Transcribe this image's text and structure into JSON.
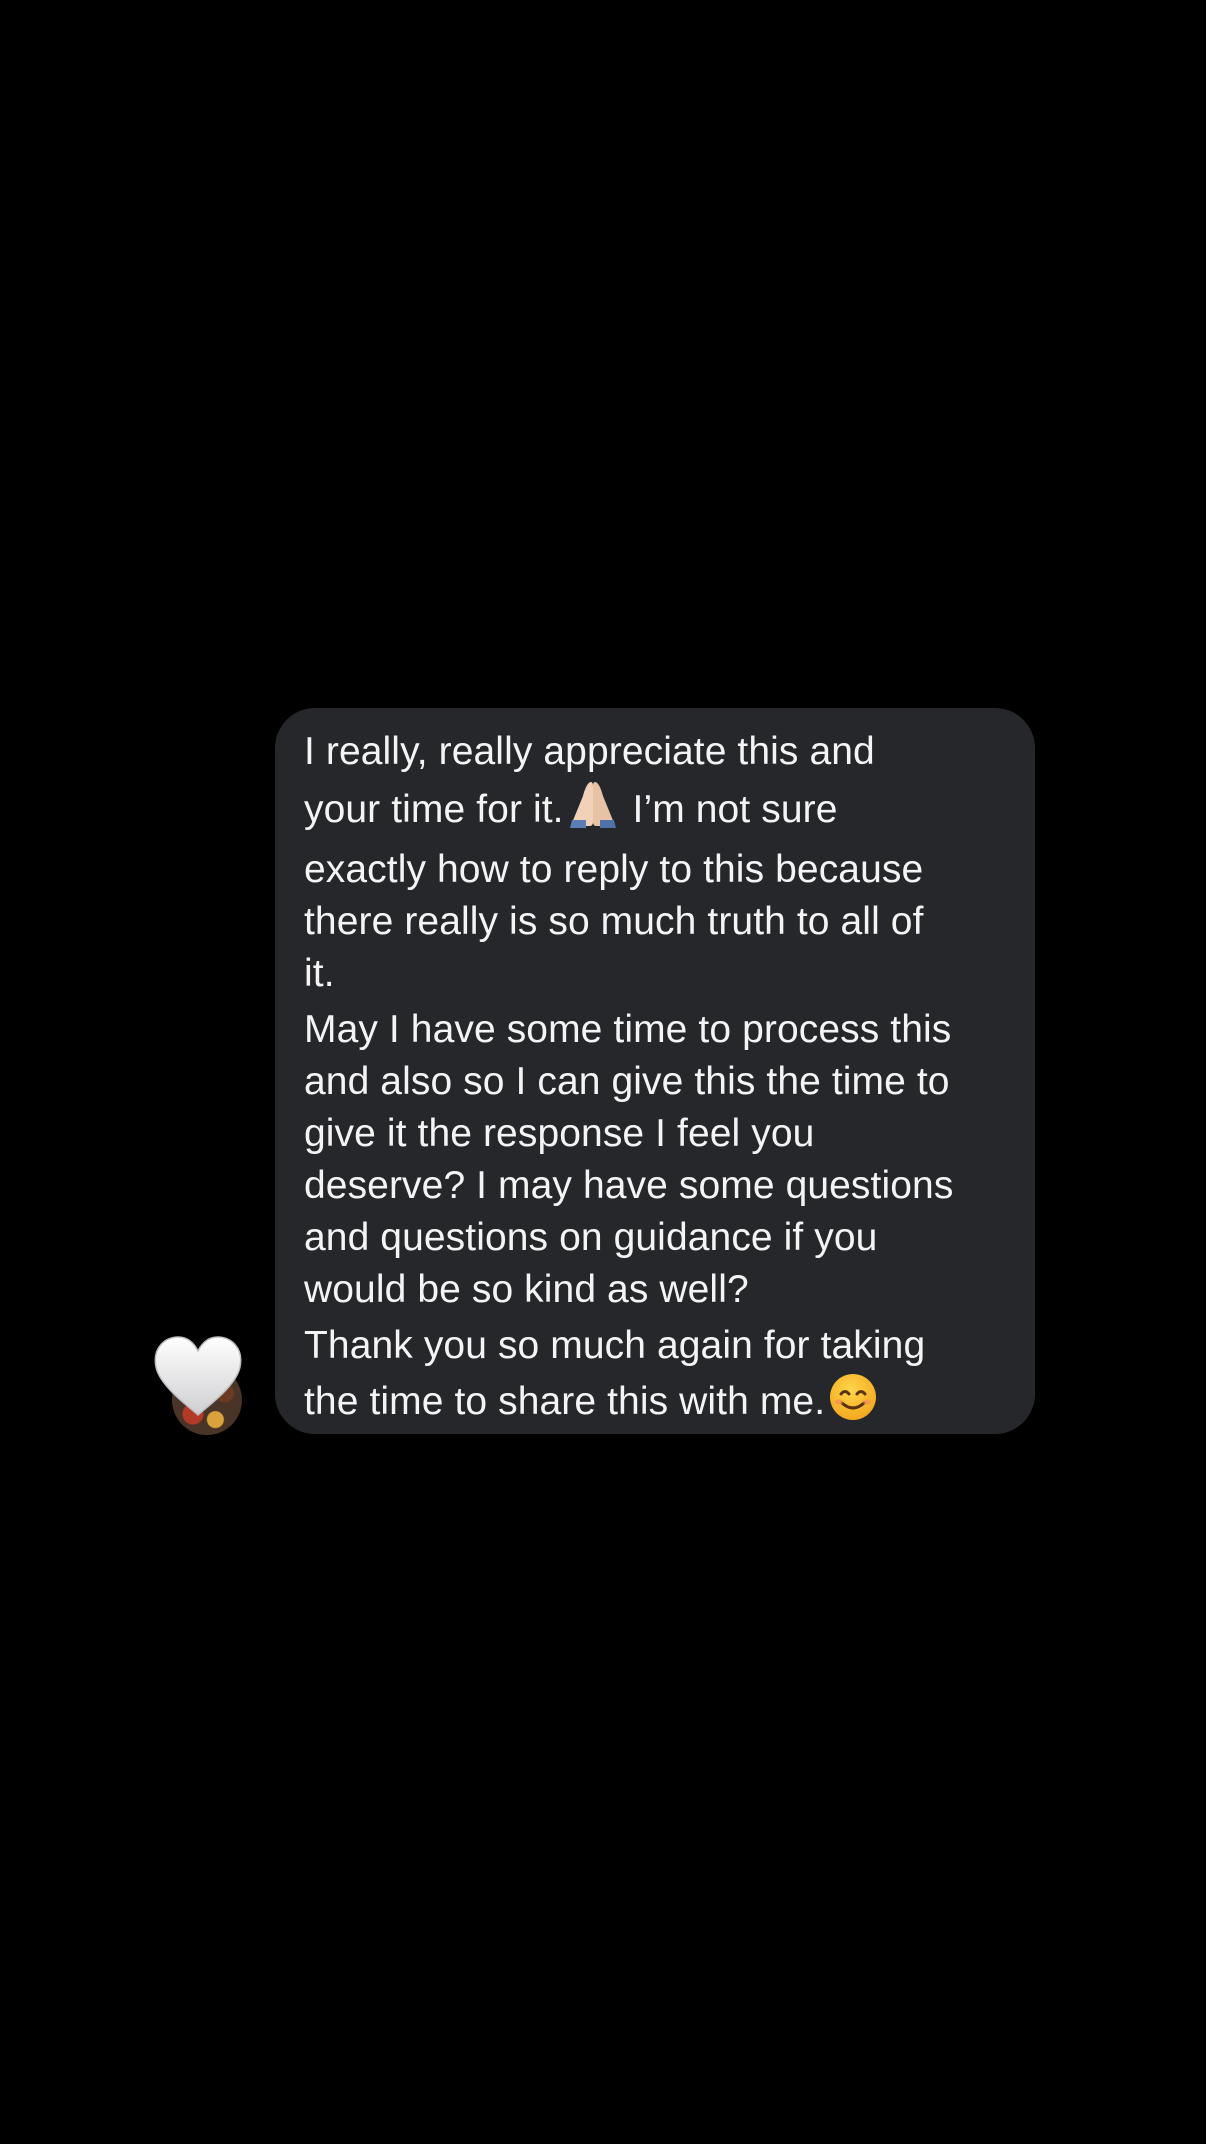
{
  "conversation": {
    "message": {
      "paragraphs": [
        {
          "lines": [
            "I really, really appreciate this and",
            "your time for it.",
            "I’m not sure",
            "exactly how to reply to this because",
            "there really is so much truth to all of",
            "it."
          ]
        },
        {
          "lines": [
            "May I have some time to process this",
            "and also so I can give this the time to",
            "give it the response I feel you",
            "deserve? I may have some questions",
            "and questions on guidance if you",
            "would be so kind as well?"
          ]
        },
        {
          "lines": [
            "Thank you so much again for taking",
            "the time to share this with me."
          ]
        }
      ],
      "emojis": {
        "first": "folded-hands-icon",
        "last": "smiling-face-icon"
      }
    },
    "reaction": {
      "icon": "white-heart-icon"
    },
    "colors": {
      "background": "#000000",
      "bubble": "#25272b",
      "text": "#f4f4f5"
    }
  }
}
